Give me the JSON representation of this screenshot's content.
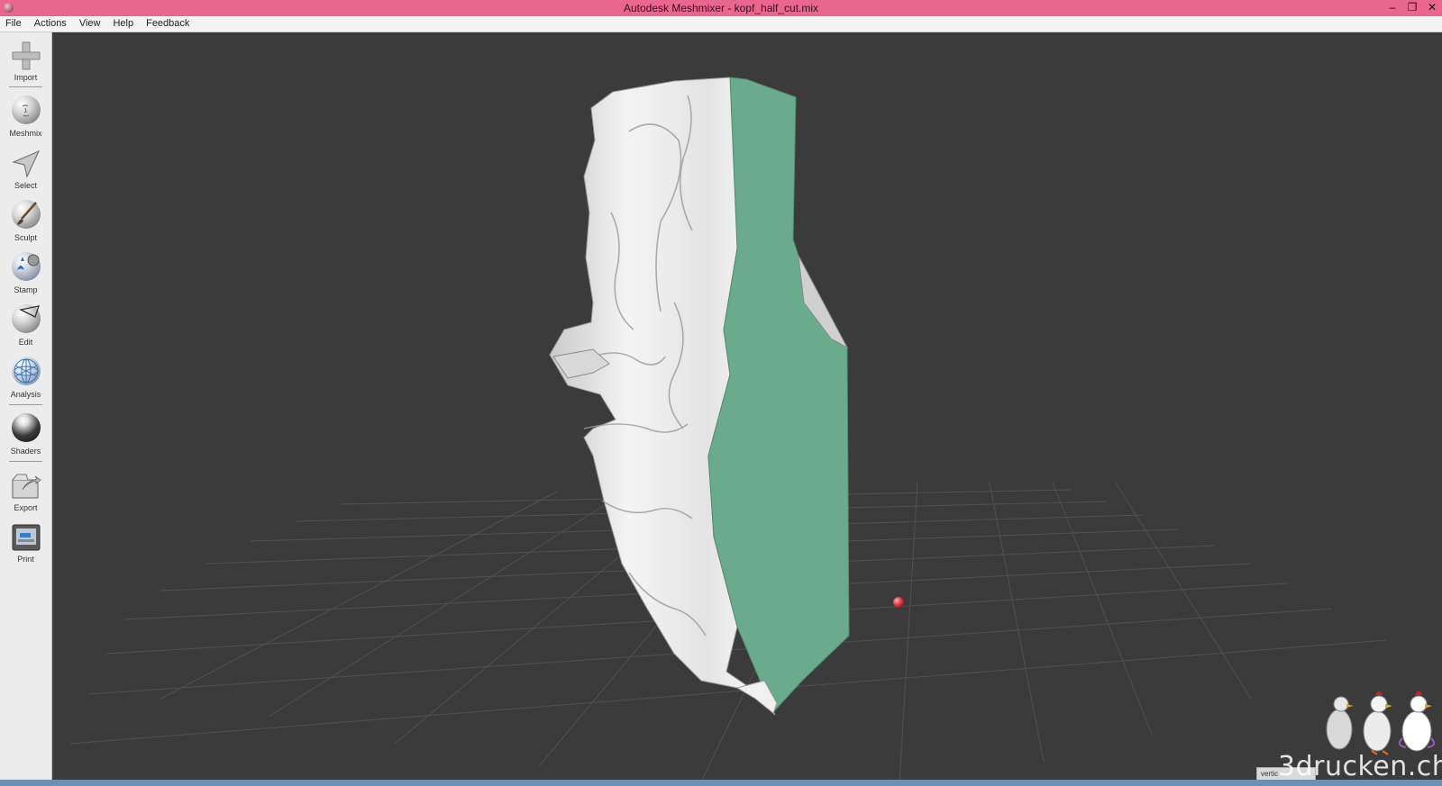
{
  "window": {
    "title": "Autodesk Meshmixer - kopf_half_cut.mix",
    "controls": {
      "minimize": "–",
      "restore": "❐",
      "close": "✕"
    }
  },
  "menu": {
    "items": [
      "File",
      "Actions",
      "View",
      "Help",
      "Feedback"
    ]
  },
  "toolbar": {
    "tools": [
      {
        "label": "Import",
        "icon": "plus-icon"
      },
      {
        "label": "Meshmix",
        "icon": "face-sphere-icon"
      },
      {
        "label": "Select",
        "icon": "arrow-pointer-icon"
      },
      {
        "label": "Sculpt",
        "icon": "brush-sphere-icon"
      },
      {
        "label": "Stamp",
        "icon": "stamp-sphere-icon"
      },
      {
        "label": "Edit",
        "icon": "edit-sphere-icon"
      },
      {
        "label": "Analysis",
        "icon": "analysis-sphere-icon"
      },
      {
        "label": "Shaders",
        "icon": "shader-sphere-icon"
      },
      {
        "label": "Export",
        "icon": "export-icon"
      },
      {
        "label": "Print",
        "icon": "print-icon"
      }
    ]
  },
  "status": {
    "text": "vertic"
  },
  "watermark": {
    "text": "3drucken.ch"
  },
  "colors": {
    "titlebar": "#e8668f",
    "viewport": "#3b3b3b",
    "cut_face": "#6aab8e",
    "mesh": "#e8e8e8",
    "pivot": "#e8434a"
  }
}
